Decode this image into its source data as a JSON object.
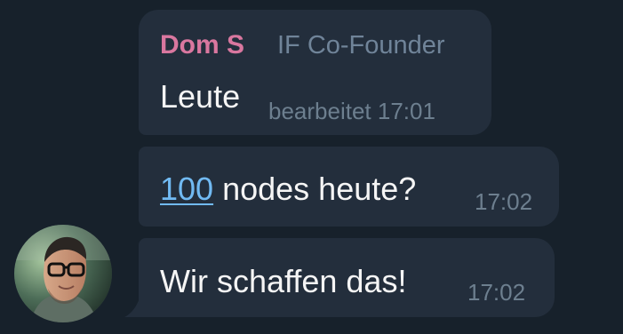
{
  "messages": [
    {
      "sender": "Dom S",
      "sender_title": "IF Co-Founder",
      "text": "Leute",
      "edited_label": "bearbeitet",
      "time": "17:01"
    },
    {
      "link_text": "100",
      "text_after_link": " nodes heute?",
      "time": "17:02"
    },
    {
      "text": "Wir schaffen das!",
      "time": "17:02"
    }
  ],
  "avatar": {
    "icon": "user-avatar-photo"
  },
  "colors": {
    "background": "#17212b",
    "bubble": "#232e3c",
    "sender_name": "#d9779f",
    "link": "#71baf3",
    "meta": "#6d7f8f",
    "text": "#f5f5f5"
  }
}
